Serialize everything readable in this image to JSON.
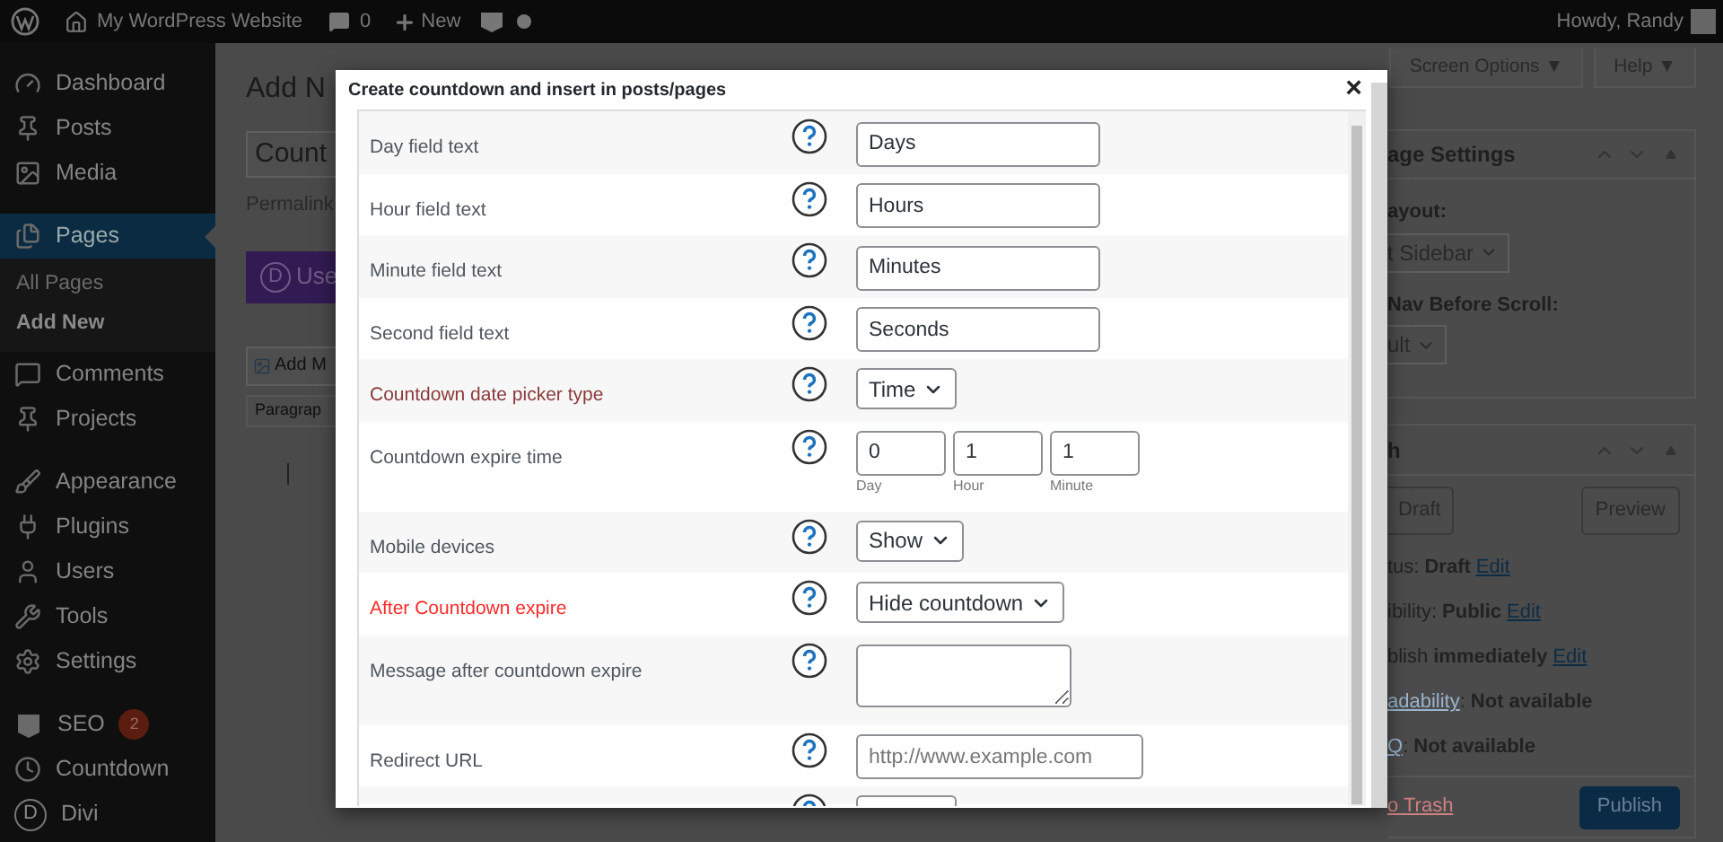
{
  "admin_bar": {
    "site": "My WordPress Website",
    "comments": "0",
    "new": "New",
    "greeting": "Howdy, Randy"
  },
  "sidebar": {
    "items": [
      {
        "label": "Dashboard",
        "selected": false
      },
      {
        "label": "Posts",
        "selected": false
      },
      {
        "label": "Media",
        "selected": false
      },
      {
        "label": "Pages",
        "selected": true,
        "children": [
          {
            "label": "All Pages",
            "selected": false
          },
          {
            "label": "Add New",
            "selected": true
          }
        ]
      },
      {
        "label": "Comments",
        "selected": false
      },
      {
        "label": "Projects",
        "selected": false
      },
      {
        "label": "Appearance",
        "selected": false
      },
      {
        "label": "Plugins",
        "selected": false
      },
      {
        "label": "Users",
        "selected": false
      },
      {
        "label": "Tools",
        "selected": false
      },
      {
        "label": "Settings",
        "selected": false
      },
      {
        "label": "SEO",
        "selected": false,
        "badge": "2"
      },
      {
        "label": "Countdown",
        "selected": false
      },
      {
        "label": "Divi",
        "selected": false,
        "letter": "D"
      }
    ]
  },
  "editor": {
    "heading": "Add N",
    "title_value": "Count",
    "permalink": "Permalink",
    "divi_letter": "D",
    "divi_button": "Use",
    "add_media": "Add M",
    "block_type": "Paragrap"
  },
  "top_buttons": [
    "Screen Options ▼",
    "Help ▼"
  ],
  "page_settings": {
    "title": "age Settings",
    "fields": [
      {
        "label": "ayout:",
        "value": "t Sidebar"
      },
      {
        "label": "Nav Before Scroll:",
        "value": "ult"
      }
    ]
  },
  "publish": {
    "title": "h",
    "save_draft": "Draft",
    "preview": "Preview",
    "meta": [
      {
        "label": "tus: ",
        "value": "Draft",
        "link": "Edit"
      },
      {
        "label": "ibility: ",
        "value": "Public",
        "link": "Edit"
      },
      {
        "label": "blish ",
        "value": "immediately",
        "link": "Edit"
      },
      {
        "prefix_link": "adability",
        "label": ": ",
        "value": "Not available"
      },
      {
        "prefix_link": "Q",
        "label": ": ",
        "value": "Not available"
      }
    ],
    "trash": "o Trash",
    "publish_button": "Publish"
  },
  "dialog": {
    "title": "Create countdown and insert in posts/pages",
    "close": "×",
    "rows": [
      {
        "label": "Day field text",
        "kind": "text",
        "value": "Days"
      },
      {
        "label": "Hour field text",
        "kind": "text",
        "value": "Hours"
      },
      {
        "label": "Minute field text",
        "kind": "text",
        "value": "Minutes"
      },
      {
        "label": "Second field text",
        "kind": "text",
        "value": "Seconds"
      },
      {
        "label": "Countdown date picker type",
        "color": "#8b3a3a",
        "kind": "select",
        "value": "Time"
      },
      {
        "label": "Countdown expire time",
        "kind": "triple",
        "parts": [
          {
            "value": "0",
            "caption": "Day"
          },
          {
            "value": "1",
            "caption": "Hour"
          },
          {
            "value": "1",
            "caption": "Minute"
          }
        ]
      },
      {
        "label": "Mobile devices",
        "kind": "select",
        "value": "Show"
      },
      {
        "label": "After Countdown expire",
        "color": "#ff2a2a",
        "kind": "select",
        "value": "Hide countdown"
      },
      {
        "label": "Message after countdown expire",
        "kind": "textarea"
      },
      {
        "label": "Redirect URL",
        "kind": "text",
        "placeholder": "http://www.example.com"
      },
      {
        "kind": "partial"
      }
    ]
  }
}
